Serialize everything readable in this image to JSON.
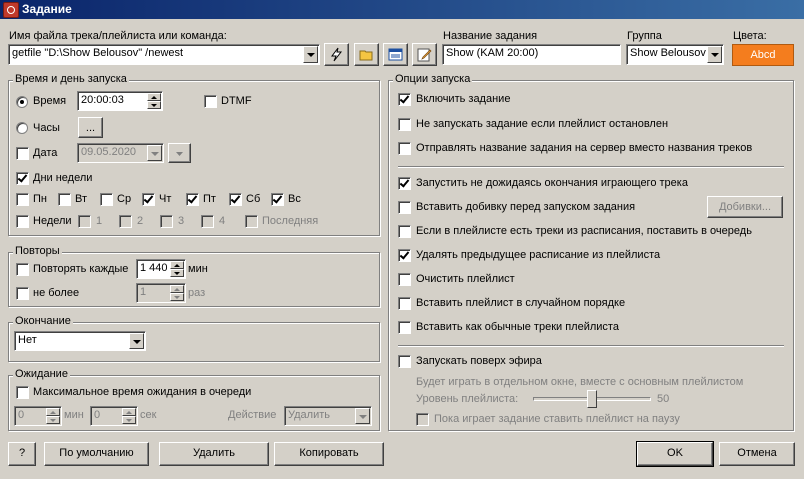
{
  "window": {
    "title": "Задание"
  },
  "header": {
    "file_label": "Имя файла трека/плейлиста или команда:",
    "file_value": "getfile \"D:\\Show Belousov\" /newest",
    "name_label": "Название задания",
    "name_value": "Show (KAM 20:00)",
    "group_label": "Группа",
    "group_value": "Show Belousov",
    "colors_label": "Цвета:",
    "color_button": "Abcd",
    "color_bg": "#f47d1e",
    "color_fg": "#ffffff"
  },
  "time": {
    "title": "Время и день запуска",
    "time_label": "Время",
    "time_value": "20:00:03",
    "dtmf_label": "DTMF",
    "hours_label": "Часы",
    "hours_btn": "...",
    "date_label": "Дата",
    "date_value": "09.05.2020",
    "weekdays_label": "Дни недели",
    "days": [
      {
        "label": "Пн",
        "checked": false
      },
      {
        "label": "Вт",
        "checked": false
      },
      {
        "label": "Ср",
        "checked": false
      },
      {
        "label": "Чт",
        "checked": true
      },
      {
        "label": "Пт",
        "checked": true
      },
      {
        "label": "Сб",
        "checked": true
      },
      {
        "label": "Вс",
        "checked": true
      }
    ],
    "weeks_label": "Недели",
    "weeks": [
      "1",
      "2",
      "3",
      "4",
      "Последняя"
    ]
  },
  "repeat": {
    "title": "Повторы",
    "every_label": "Повторять каждые",
    "every_value": "1 440",
    "every_unit": "мин",
    "max_label": "не более",
    "max_value": "1",
    "max_unit": "раз"
  },
  "ending": {
    "title": "Окончание",
    "value": "Нет"
  },
  "waiting": {
    "title": "Ожидание",
    "max_label": "Максимальное время ожидания в очереди",
    "min_value": "0",
    "min_unit": "мин",
    "sec_value": "0",
    "sec_unit": "сек",
    "action_label": "Действие",
    "action_value": "Удалить"
  },
  "options": {
    "title": "Опции запуска",
    "items": [
      {
        "label": "Включить задание",
        "checked": true
      },
      {
        "label": "Не запускать задание если плейлист остановлен",
        "checked": false
      },
      {
        "label": "Отправлять название задания на сервер вместо названия треков",
        "checked": false
      },
      {
        "label": "Запустить не дожидаясь окончания играющего трека",
        "checked": true
      },
      {
        "label": "Вставить добивку перед запуском задания",
        "checked": false
      },
      {
        "label": "Если в плейлисте есть треки из расписания, поставить в очередь",
        "checked": false
      },
      {
        "label": "Удалять предыдущее расписание из плейлиста",
        "checked": true
      },
      {
        "label": "Очистить плейлист",
        "checked": false
      },
      {
        "label": "Вставить плейлист в случайном порядке",
        "checked": false
      },
      {
        "label": "Вставить как обычные треки плейлиста",
        "checked": false
      }
    ],
    "fillers_btn": "Добивки...",
    "on_air_label": "Запускать поверх эфира",
    "on_air_note": "Будет играть в отдельном окне, вместе с основным плейлистом",
    "level_label": "Уровень плейлиста:",
    "level_value": "50",
    "level_fraction": 0.5,
    "pause_label": "Пока играет задание ставить плейлист на паузу"
  },
  "footer": {
    "help": "?",
    "default": "По умолчанию",
    "delete": "Удалить",
    "copy": "Копировать",
    "ok": "OK",
    "cancel": "Отмена"
  }
}
